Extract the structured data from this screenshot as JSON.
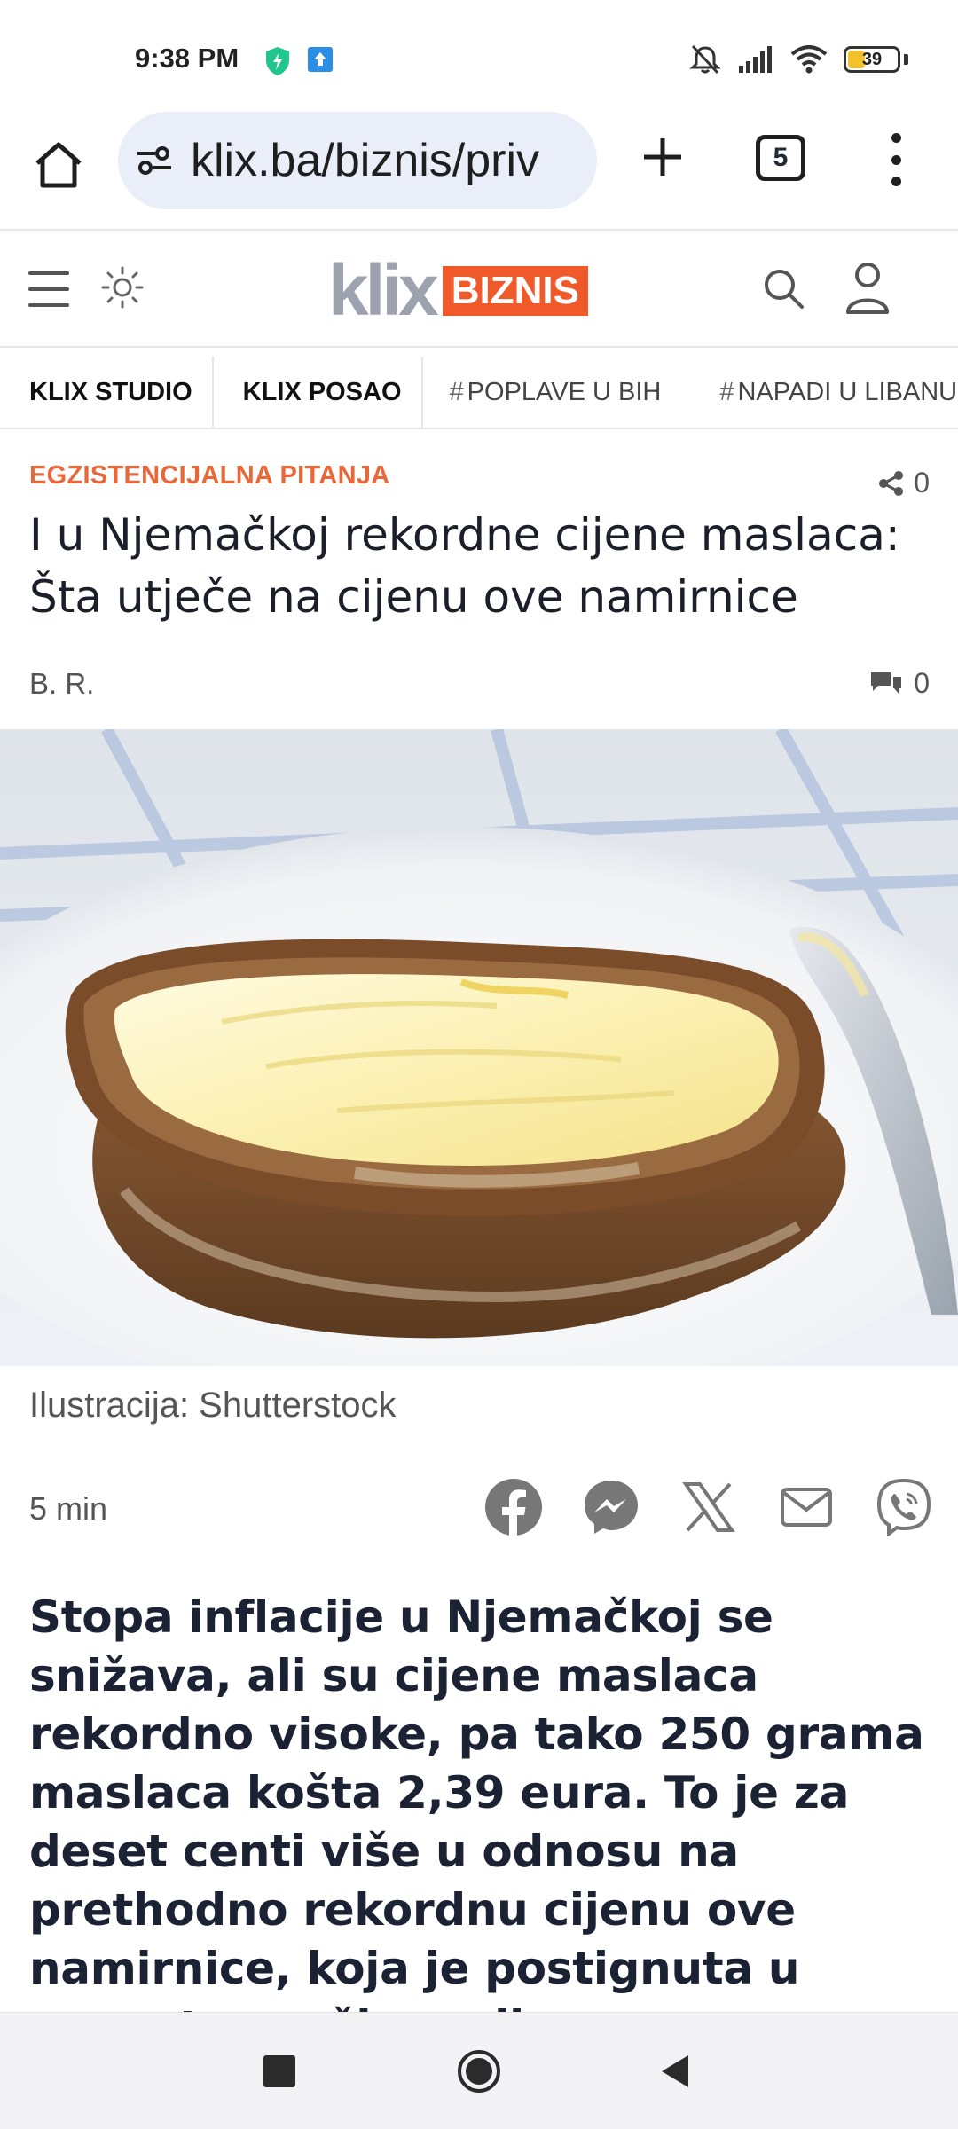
{
  "status_bar": {
    "time": "9:38 PM",
    "battery_level": "39",
    "battery_fraction": 0.39,
    "icons": [
      "shield-icon",
      "upload-notification-icon",
      "silent-icon",
      "signal-icon",
      "wifi-icon",
      "battery-icon"
    ]
  },
  "browser": {
    "url": "klix.ba/biznis/priv",
    "tab_count": "5",
    "icons": [
      "home-icon",
      "site-settings-icon",
      "plus-icon",
      "tabs-icon",
      "more-vert-icon"
    ]
  },
  "site": {
    "logo_text": "klix",
    "logo_section": "BIZNIS",
    "brand_color": "#f05a2a",
    "icons": [
      "hamburger-icon",
      "sun-icon",
      "search-icon",
      "user-icon"
    ]
  },
  "categories": [
    {
      "label": "KLIX STUDIO",
      "tag": false
    },
    {
      "label": "KLIX POSAO",
      "tag": false
    },
    {
      "label": "POPLAVE U BIH",
      "tag": true
    },
    {
      "label": "NAPADI U LIBANU",
      "tag": true
    }
  ],
  "article": {
    "kicker": "EGZISTENCIJALNA PITANJA",
    "share_count": "0",
    "headline": "I u Njemačkoj rekordne cijene maslaca: Šta utječe na cijenu ove namirnice",
    "author": "B. R.",
    "comment_count": "0",
    "image_caption": "Ilustracija: Shutterstock",
    "read_time": "5 min",
    "share_icons": [
      "facebook-icon",
      "messenger-icon",
      "x-icon",
      "email-icon",
      "viber-icon"
    ],
    "lead": "Stopa inflacije u Njemačkoj se snižava, ali su cijene maslaca rekordno visoke, pa tako 250 grama maslaca košta 2,39 eura. To je za deset centi više u odnosu na prethodno rekordnu cijenu ove namirnice, koja je postignuta u augustu prošle godine."
  },
  "nav": {
    "icons": [
      "recents-icon",
      "home-circle-icon",
      "back-icon"
    ]
  }
}
